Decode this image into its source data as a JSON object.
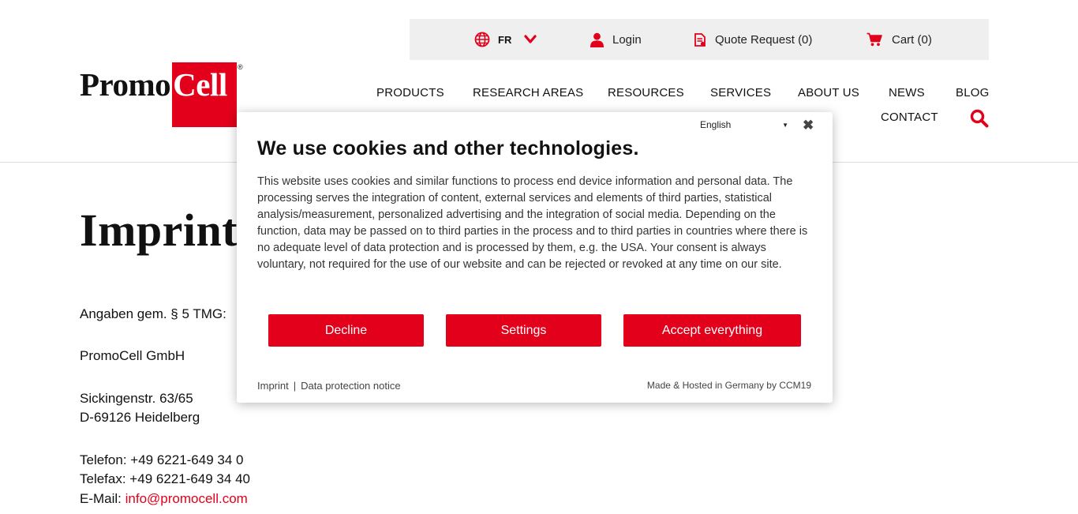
{
  "topbar": {
    "language_code": "FR",
    "login_label": "Login",
    "quote_label": "Quote Request (0)",
    "cart_label": "Cart (0)"
  },
  "logo": {
    "promo": "Promo",
    "cell": "Cell",
    "reg": "®"
  },
  "nav": {
    "products": "PRODUCTS",
    "research_areas": "RESEARCH AREAS",
    "resources": "RESOURCES",
    "services": "SERVICES",
    "about_us": "ABOUT US",
    "news": "NEWS",
    "blog": "BLOG",
    "contact": "CONTACT"
  },
  "page": {
    "title": "Imprint",
    "legal_line": "Angaben gem. § 5 TMG:",
    "company": "PromoCell GmbH",
    "street": "Sickingenstr. 63/65",
    "city": "D-69126 Heidelberg",
    "phone": "Telefon: +49 6221-649 34 0",
    "fax": "Telefax: +49 6221-649 34 40",
    "email_label": "E-Mail: ",
    "email": "info@promocell.com"
  },
  "cookie_modal": {
    "language": "English",
    "title": "We use cookies and other technologies.",
    "body": "This website uses cookies and similar functions to process end device information and personal data. The processing serves the integration of content, external services and elements of third parties, statistical analysis/measurement, personalized advertising and the integration of social media. Depending on the function, data may be passed on to third parties in the process and to third parties in countries where there is no adequate level of data protection and is processed by them, e.g. the USA. Your consent is always voluntary, not required for the use of our website and can be rejected or revoked at any time on our site.",
    "decline_label": "Decline",
    "settings_label": "Settings",
    "accept_label": "Accept everything",
    "imprint_link": "Imprint",
    "separator": "|",
    "privacy_link": "Data protection notice",
    "made_by": "Made & Hosted in Germany by CCM19"
  },
  "colors": {
    "brand_red": "#e2001a",
    "topbar_bg": "#efefef"
  },
  "icons": [
    "globe-icon",
    "chevron-down-icon",
    "user-icon",
    "document-icon",
    "cart-icon",
    "search-icon",
    "close-icon"
  ]
}
